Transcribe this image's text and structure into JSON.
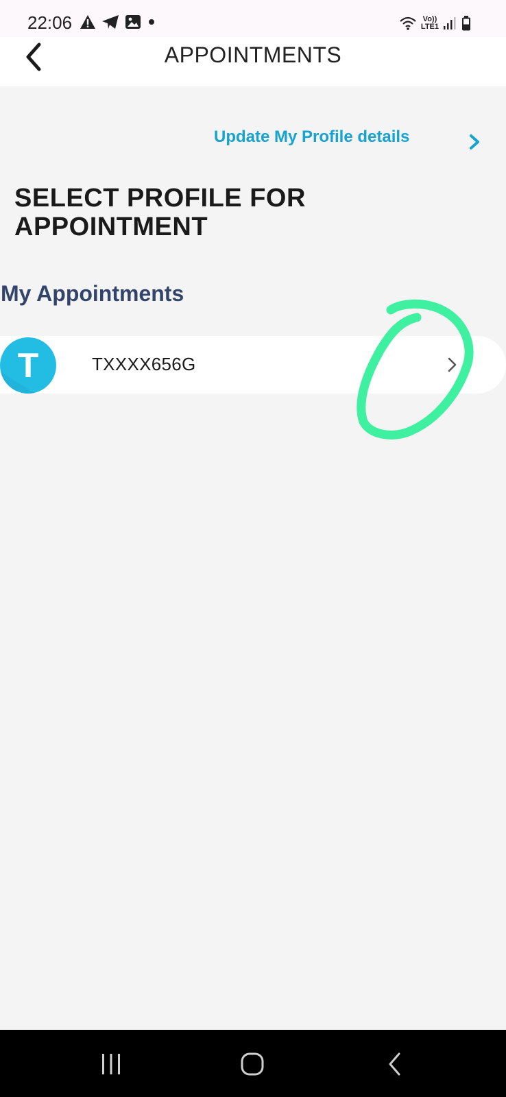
{
  "status_bar": {
    "time": "22:06",
    "left_icons": [
      "warning-icon",
      "telegram-icon",
      "image-icon",
      "dot-icon"
    ],
    "right_icons": [
      "wifi-icon",
      "volte-icon",
      "signal-icon",
      "battery-icon"
    ],
    "network_label_top": "Vo))",
    "network_label_bottom": "LTE1"
  },
  "header": {
    "title": "APPOINTMENTS",
    "back_icon": "chevron-left-icon"
  },
  "update_profile_link": {
    "label": "Update My Profile details",
    "icon": "chevron-right-icon"
  },
  "page_heading": "SELECT PROFILE FOR APPOINTMENT",
  "section_label": "My Appointments",
  "profiles": [
    {
      "initial": "T",
      "id": "TXXXX656G",
      "icon": "chevron-right-icon"
    }
  ],
  "annotation": {
    "color": "#3ef0a0",
    "shape": "hand-drawn-circle"
  },
  "colors": {
    "accent": "#16a3cf",
    "avatar": "#23bde4",
    "section_label": "#33446a",
    "background": "#f4f4f4"
  },
  "nav_bar": {
    "buttons": [
      "recents-icon",
      "home-icon",
      "back-icon"
    ]
  }
}
